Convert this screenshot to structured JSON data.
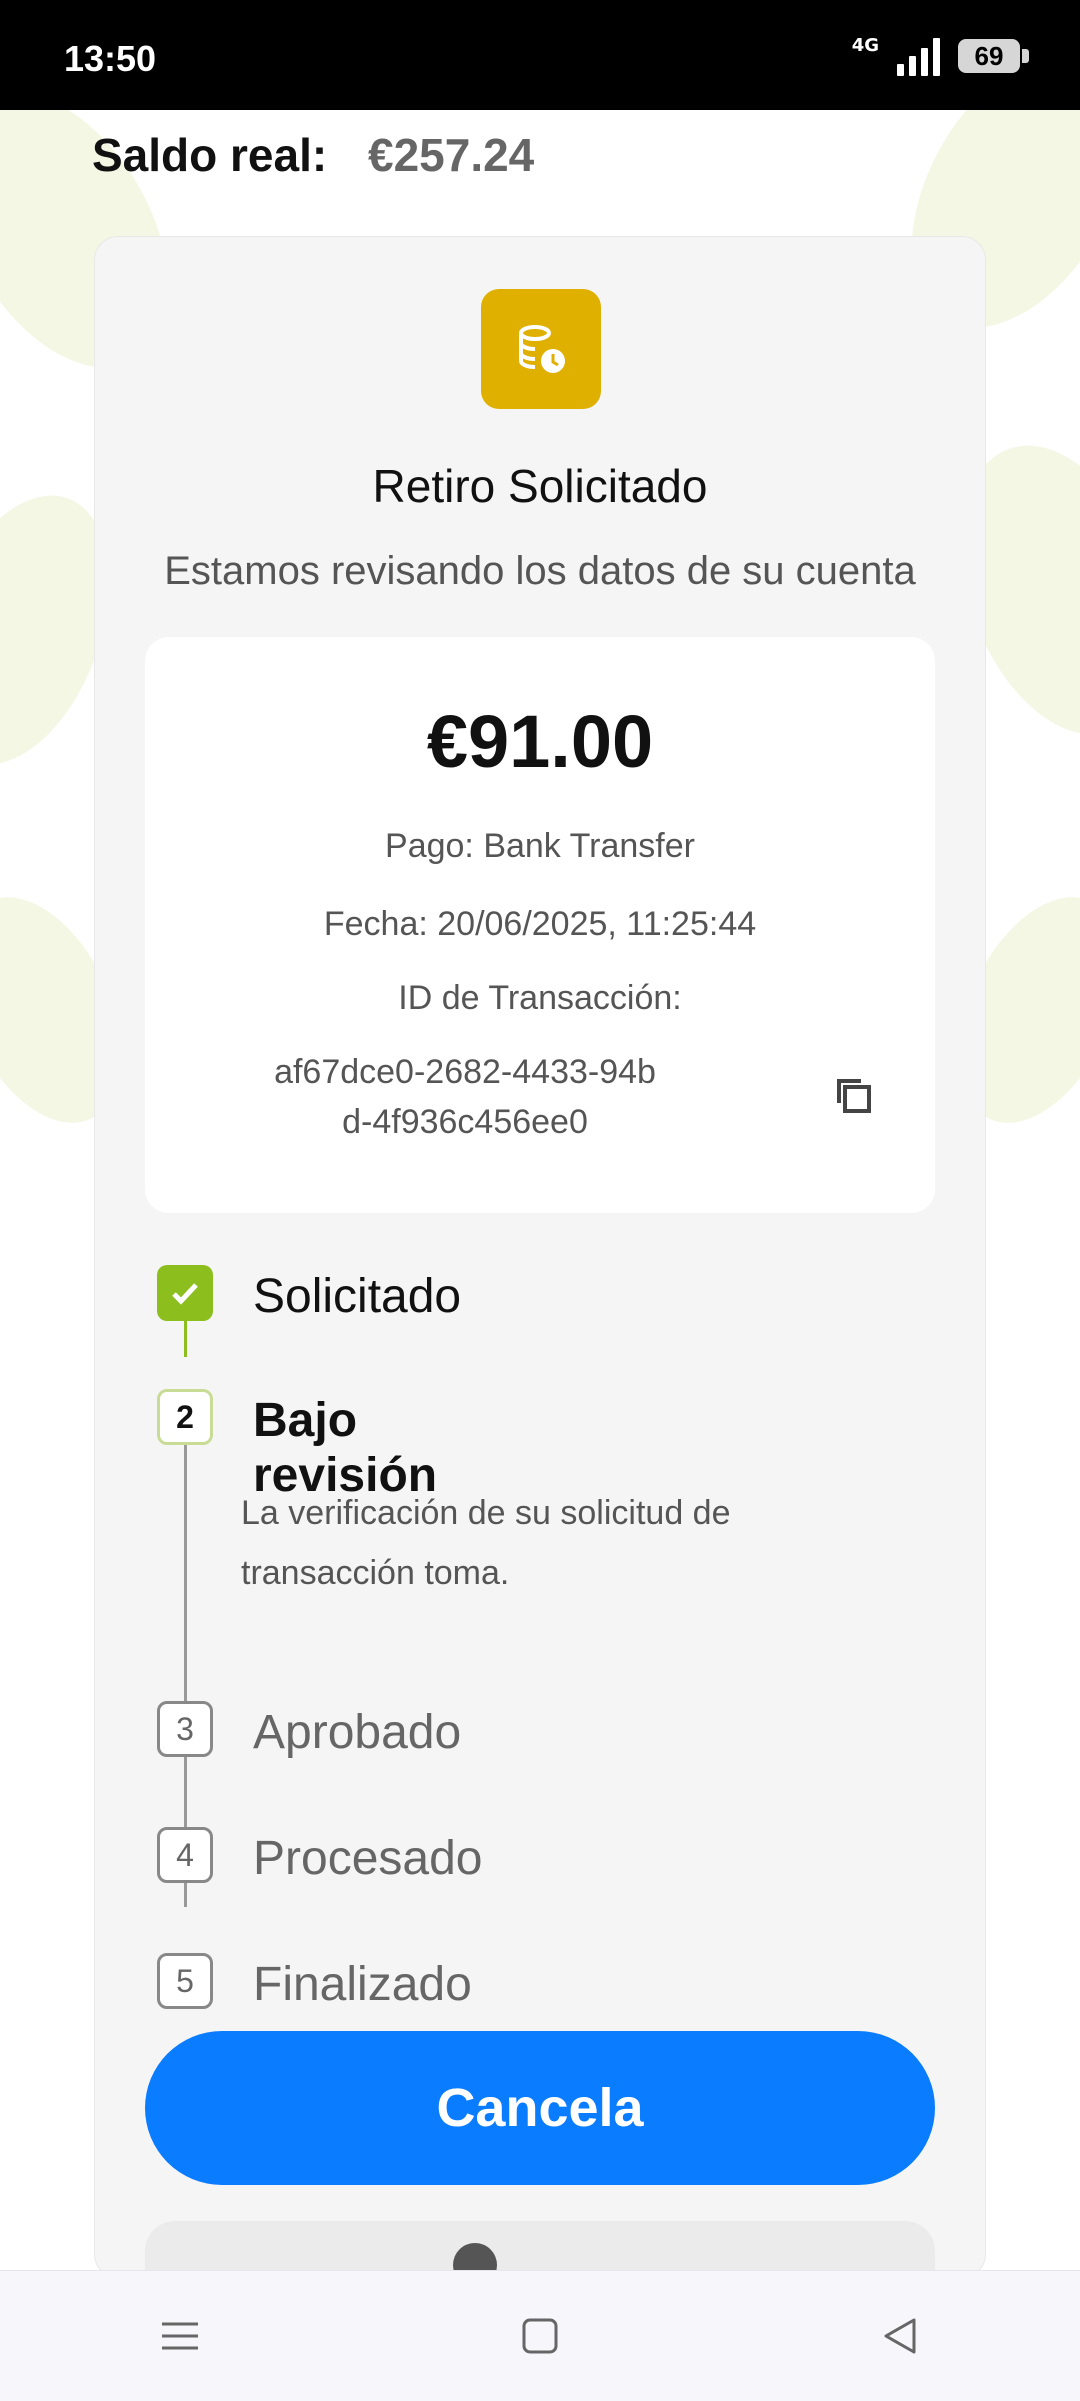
{
  "status_bar": {
    "time": "13:50",
    "network": "4G",
    "battery": "69"
  },
  "balance": {
    "label": "Saldo real:",
    "amount": "€257.24"
  },
  "withdrawal": {
    "title": "Retiro Solicitado",
    "subtitle": "Estamos revisando los datos de su cuenta",
    "amount": "€91.00",
    "payment": "Pago: Bank Transfer",
    "date": "Fecha: 20/06/2025, 11:25:44",
    "transaction_label": "ID de Transacción:",
    "transaction_id": "af67dce0-2682-4433-94bd-4f936c456ee0"
  },
  "steps": [
    {
      "number": "1",
      "label": "Solicitado",
      "state": "done"
    },
    {
      "number": "2",
      "label": "Bajo revisión",
      "state": "current",
      "description": "La verificación de su solicitud de transacción toma."
    },
    {
      "number": "3",
      "label": "Aprobado",
      "state": "pending"
    },
    {
      "number": "4",
      "label": "Procesado",
      "state": "pending"
    },
    {
      "number": "5",
      "label": "Finalizado",
      "state": "pending"
    }
  ],
  "actions": {
    "cancel_label": "Cancela"
  },
  "colors": {
    "accent": "#0a7cff",
    "step_done": "#8cbf1e",
    "pending_icon": "#e0b000"
  },
  "nav_icons": [
    "menu-icon",
    "home-square-icon",
    "back-triangle-icon"
  ]
}
